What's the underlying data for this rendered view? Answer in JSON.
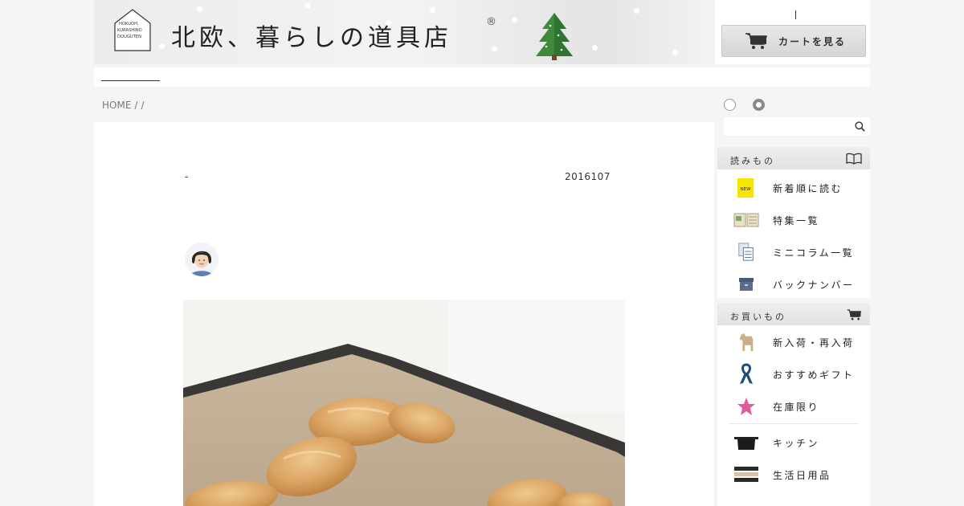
{
  "header": {
    "logo_house_text": [
      "HOKUOH,",
      "KURASHINO",
      "DOUGUTEN"
    ],
    "title": "北欧、暮らしの道具店",
    "registered_mark": "®",
    "cart_label": "カートを見る",
    "divider": "|"
  },
  "breadcrumb": {
    "home": "HOME",
    "sep1": "/",
    "sep2": "/"
  },
  "article": {
    "dash": "-",
    "date": "2016107"
  },
  "search": {
    "placeholder": ""
  },
  "sidebar": {
    "read": {
      "heading": "読みもの",
      "heading_icon": "book-icon",
      "items": [
        {
          "label": "新着順に読む",
          "icon": "new-badge-icon"
        },
        {
          "label": "特集一覧",
          "icon": "magazine-icon"
        },
        {
          "label": "ミニコラム一覧",
          "icon": "document-icon"
        },
        {
          "label": "バックナンバー",
          "icon": "archive-box-icon"
        }
      ]
    },
    "shop": {
      "heading": "お買いもの",
      "heading_icon": "cart-icon",
      "items": [
        {
          "label": "新入荷・再入荷",
          "icon": "dala-horse-icon"
        },
        {
          "label": "おすすめギフト",
          "icon": "ribbon-icon"
        },
        {
          "label": "在庫限り",
          "icon": "star-icon"
        },
        {
          "label": "キッチン",
          "icon": "pot-icon"
        },
        {
          "label": "生活日用品",
          "icon": "towels-icon"
        }
      ]
    }
  },
  "colors": {
    "page_bg": "#f5f5f5",
    "new_badge": "#f6e500",
    "ribbon": "#1f4e79",
    "star": "#e05a9c",
    "tree": "#3f8a3a"
  }
}
